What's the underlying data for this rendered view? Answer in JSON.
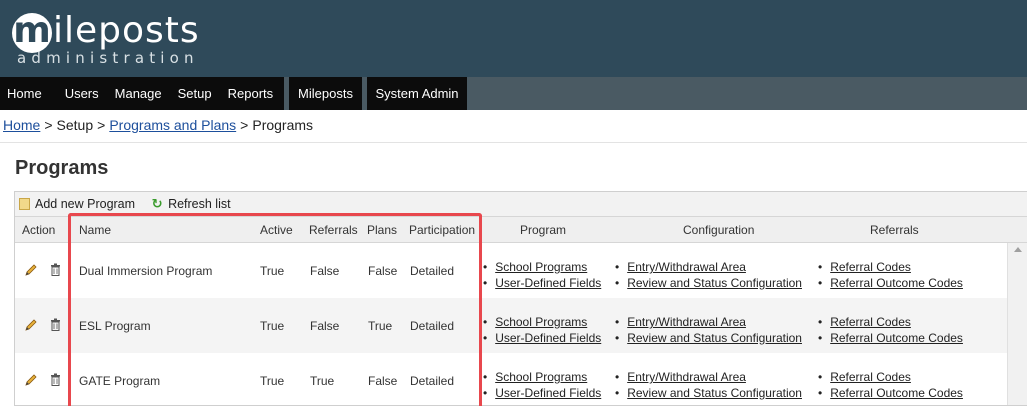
{
  "brand": {
    "letter": "m",
    "word": "ileposts",
    "subtitle": "administration"
  },
  "nav": {
    "items": [
      "Home",
      "Users",
      "Manage",
      "Setup",
      "Reports"
    ],
    "mileposts": "Mileposts",
    "system_admin": "System Admin"
  },
  "breadcrumb": {
    "home": "Home",
    "sep": ">",
    "setup": "Setup",
    "programs_and_plans": "Programs and Plans",
    "current": "Programs"
  },
  "page": {
    "title": "Programs"
  },
  "toolbar": {
    "add_label": "Add new Program",
    "refresh_label": "Refresh list"
  },
  "columns": {
    "action": "Action",
    "name": "Name",
    "active": "Active",
    "referrals": "Referrals",
    "plans": "Plans",
    "participation": "Participation",
    "program": "Program",
    "configuration": "Configuration",
    "referrals_group": "Referrals"
  },
  "rows": [
    {
      "name": "Dual Immersion Program",
      "active": "True",
      "referrals": "False",
      "plans": "False",
      "participation": "Detailed"
    },
    {
      "name": "ESL Program",
      "active": "True",
      "referrals": "False",
      "plans": "True",
      "participation": "Detailed"
    },
    {
      "name": "GATE Program",
      "active": "True",
      "referrals": "True",
      "plans": "False",
      "participation": "Detailed"
    }
  ],
  "links": {
    "program": [
      "School Programs",
      "User-Defined Fields"
    ],
    "configuration": [
      "Entry/Withdrawal Area",
      "Review and Status Configuration"
    ],
    "referrals": [
      "Referral Codes",
      "Referral Outcome Codes"
    ]
  },
  "colors": {
    "header_bg": "#2f4a5a",
    "nav_bg": "#0c0c0c",
    "link": "#1d4f9c",
    "highlight": "#e8474d"
  }
}
